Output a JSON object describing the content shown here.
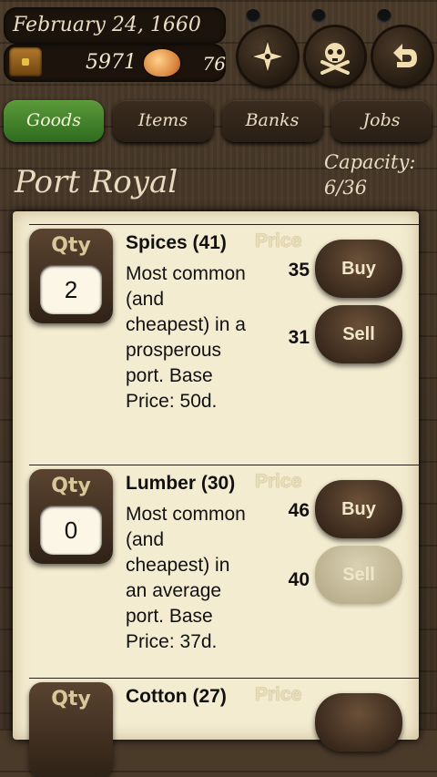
{
  "header": {
    "date": "February 24, 1660",
    "gold": "5971",
    "food": "76",
    "buttons": [
      "compass-icon",
      "skull-crossbones-icon",
      "back-arrow-icon"
    ]
  },
  "tabs": [
    {
      "label": "Goods",
      "active": true
    },
    {
      "label": "Items",
      "active": false
    },
    {
      "label": "Banks",
      "active": false
    },
    {
      "label": "Jobs",
      "active": false
    }
  ],
  "port": {
    "name": "Port Royal",
    "capacity_label": "Capacity:",
    "capacity_value": "6/36"
  },
  "goods": [
    {
      "qty_label": "Qty",
      "qty": "2",
      "title": "Spices (41)",
      "price_label": "Price",
      "description": "Most common (and cheapest) in a prosperous port. Base Price: 50d.",
      "buy_price": "35",
      "sell_price": "31",
      "buy_label": "Buy",
      "sell_label": "Sell",
      "sell_enabled": true
    },
    {
      "qty_label": "Qty",
      "qty": "0",
      "title": "Lumber (30)",
      "price_label": "Price",
      "description": "Most common (and cheapest) in an average port. Base Price: 37d.",
      "buy_price": "46",
      "sell_price": "40",
      "buy_label": "Buy",
      "sell_label": "Sell",
      "sell_enabled": false
    },
    {
      "qty_label": "Qty",
      "title": "Cotton (27)",
      "price_label": "Price"
    }
  ]
}
